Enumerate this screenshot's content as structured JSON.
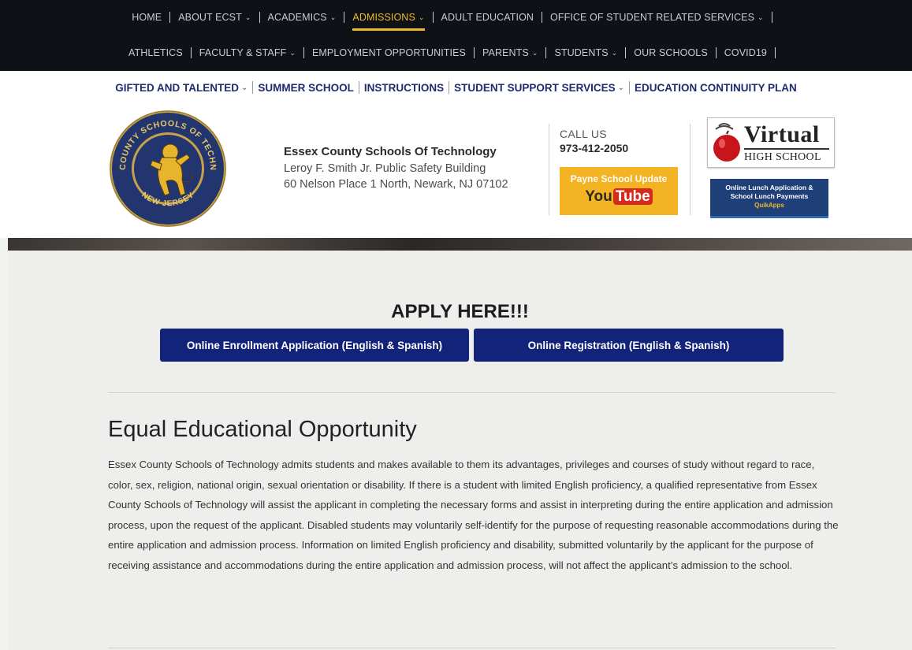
{
  "top_nav": {
    "row1": [
      {
        "label": "HOME",
        "dropdown": false,
        "active": false
      },
      {
        "label": "ABOUT ECST",
        "dropdown": true,
        "active": false
      },
      {
        "label": "ACADEMICS",
        "dropdown": true,
        "active": false
      },
      {
        "label": "ADMISSIONS",
        "dropdown": true,
        "active": true
      },
      {
        "label": "ADULT EDUCATION",
        "dropdown": false,
        "active": false
      },
      {
        "label": "OFFICE OF STUDENT RELATED SERVICES",
        "dropdown": true,
        "active": false
      }
    ],
    "row2": [
      {
        "label": "ATHLETICS",
        "dropdown": false,
        "active": false
      },
      {
        "label": "FACULTY & STAFF",
        "dropdown": true,
        "active": false
      },
      {
        "label": "EMPLOYMENT OPPORTUNITIES",
        "dropdown": false,
        "active": false
      },
      {
        "label": "PARENTS",
        "dropdown": true,
        "active": false
      },
      {
        "label": "STUDENTS",
        "dropdown": true,
        "active": false
      },
      {
        "label": "OUR SCHOOLS",
        "dropdown": false,
        "active": false
      },
      {
        "label": "COVID19",
        "dropdown": false,
        "active": false
      }
    ],
    "active_color": "#f0b92b"
  },
  "sub_nav": [
    {
      "label": "GIFTED AND TALENTED",
      "dropdown": true
    },
    {
      "label": "SUMMER SCHOOL",
      "dropdown": false
    },
    {
      "label": "INSTRUCTIONS",
      "dropdown": false
    },
    {
      "label": "STUDENT SUPPORT SERVICES",
      "dropdown": true
    },
    {
      "label": "EDUCATION CONTINUITY PLAN",
      "dropdown": false
    }
  ],
  "header": {
    "seal_text_top": "ESSEX COUNTY SCHOOLS OF TECHNOLOGY",
    "seal_text_bottom": "NEW JERSEY",
    "school_name": "Essex County Schools Of Technology",
    "building": "Leroy F. Smith Jr. Public Safety Building",
    "address": "60 Nelson Place 1 North, Newark, NJ 07102",
    "call_label": "CALL US",
    "phone": "973-412-2050",
    "youtube_title": "Payne School Update",
    "youtube_you": "You",
    "youtube_tube": "Tube",
    "virtual_word": "Virtual",
    "virtual_sub": "HIGH SCHOOL",
    "lunch_line1": "Online Lunch Application &",
    "lunch_line2": "School Lunch Payments",
    "lunch_brand": "QuikApps"
  },
  "apply": {
    "title": "APPLY HERE!!!",
    "button_enrollment": "Online Enrollment Application (English & Spanish)",
    "button_registration": "Online Registration (English & Spanish)",
    "button_color": "#13237a"
  },
  "eeo": {
    "title": "Equal Educational Opportunity",
    "body": "Essex County Schools of Technology admits students and makes available to them its advantages, privileges and courses of study without regard to race, color, sex, religion, national origin, sexual orientation or disability. If there is a student with limited English proficiency, a qualified representative from Essex County Schools of Technology will assist the applicant in completing the necessary forms and assist in interpreting during the entire application and admission process, upon the request of the applicant. Disabled students may voluntarily self-identify for the purpose of requesting reasonable accommodations during the entire application and admission process. Information on limited English proficiency and disability, submitted voluntarily by the applicant for the purpose of receiving assistance and accommodations during the entire application and admission process, will not affect the applicant’s admission to the school."
  }
}
